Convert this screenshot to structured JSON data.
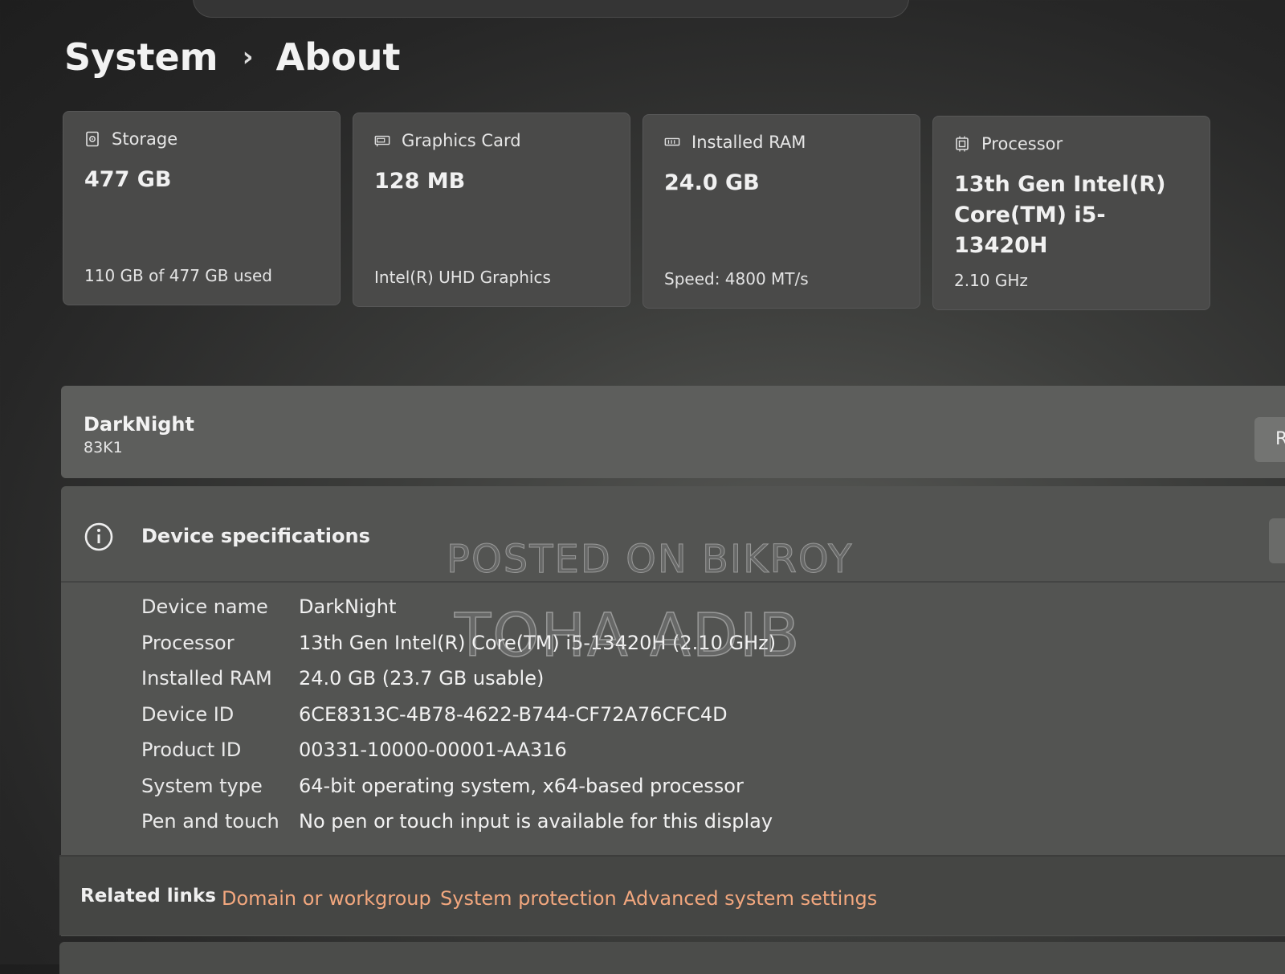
{
  "breadcrumb": {
    "parent": "System",
    "separator": "›",
    "current": "About"
  },
  "cards": [
    {
      "icon": "storage-icon",
      "label": "Storage",
      "value": "477 GB",
      "sub": "110 GB of 477 GB used"
    },
    {
      "icon": "graphics-card-icon",
      "label": "Graphics Card",
      "value": "128 MB",
      "sub": "Intel(R) UHD Graphics"
    },
    {
      "icon": "ram-icon",
      "label": "Installed RAM",
      "value": "24.0 GB",
      "sub": "Speed: 4800 MT/s"
    },
    {
      "icon": "processor-icon",
      "label": "Processor",
      "value": "13th Gen Intel(R) Core(TM) i5-13420H",
      "sub": "2.10 GHz"
    }
  ],
  "device": {
    "name": "DarkNight",
    "model": "83K1",
    "rename_label": "R"
  },
  "specs": {
    "title": "Device specifications",
    "rows": [
      {
        "label": "Device name",
        "value": "DarkNight"
      },
      {
        "label": "Processor",
        "value": "13th Gen Intel(R) Core(TM) i5-13420H (2.10 GHz)"
      },
      {
        "label": "Installed RAM",
        "value": "24.0 GB (23.7 GB usable)"
      },
      {
        "label": "Device ID",
        "value": "6CE8313C-4B78-4622-B744-CF72A76CFC4D"
      },
      {
        "label": "Product ID",
        "value": "00331-10000-00001-AA316"
      },
      {
        "label": "System type",
        "value": "64-bit operating system, x64-based processor"
      },
      {
        "label": "Pen and touch",
        "value": "No pen or touch input is available for this display"
      }
    ]
  },
  "related": {
    "label": "Related links",
    "links": [
      "Domain or workgroup",
      "System protection",
      "Advanced system settings"
    ]
  },
  "watermark": {
    "line1": "POSTED ON BIKROY",
    "line2": "TOHA ADIB"
  },
  "colors": {
    "link": "#f2a77e",
    "card_bg": "#4a4a49",
    "page_bg": "#262626"
  }
}
